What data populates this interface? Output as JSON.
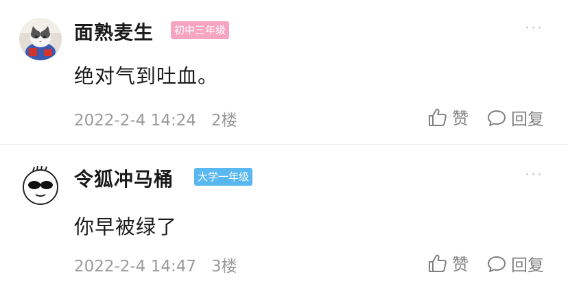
{
  "comments": [
    {
      "username": "面熟麦生",
      "badge": "初中三年级",
      "content": "绝对气到吐血。",
      "timestamp": "2022-2-4 14:24",
      "floor": "2楼",
      "like_label": "赞",
      "reply_label": "回复",
      "avatar_icon": "cat-photo-avatar"
    },
    {
      "username": "令狐冲马桶",
      "badge": "大学一年级",
      "content": "你早被绿了",
      "timestamp": "2022-2-4 14:47",
      "floor": "3楼",
      "like_label": "赞",
      "reply_label": "回复",
      "avatar_icon": "sunglasses-cartoon-avatar"
    }
  ],
  "more_icon_label": "···",
  "colors": {
    "badge_junior": "#f7a4c1",
    "badge_college": "#59b8f0",
    "text_primary": "#1a1a1a",
    "text_meta": "#9a9a9a"
  }
}
